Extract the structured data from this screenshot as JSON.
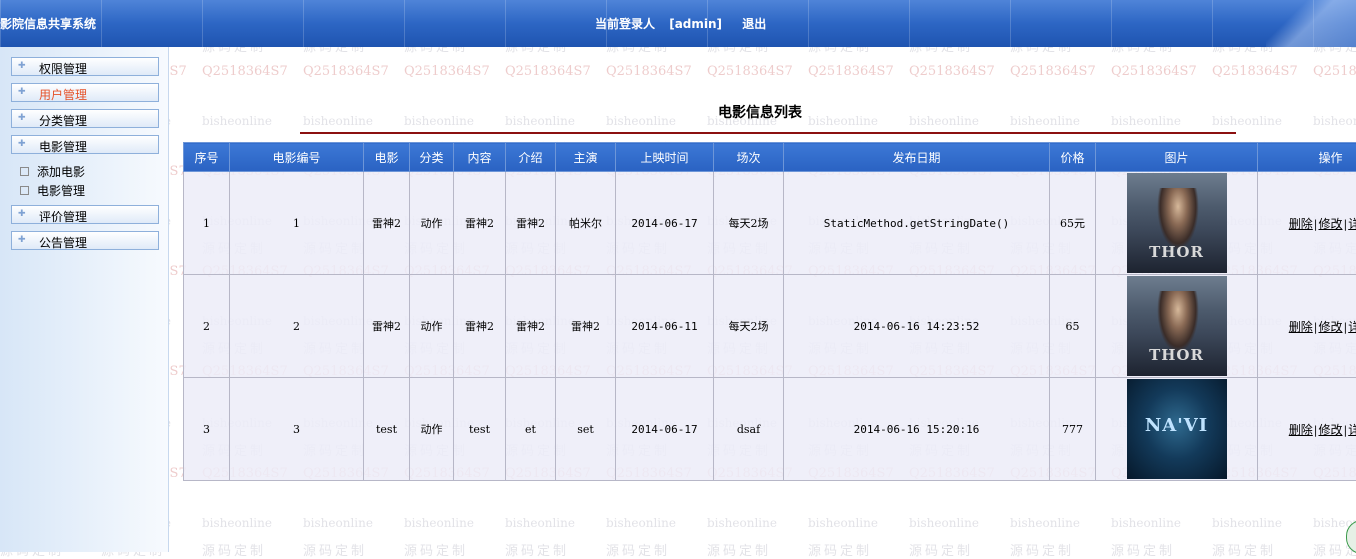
{
  "header": {
    "system_title": "影院信息共享系统",
    "current_user_label": "当前登录人",
    "current_user": "[admin]",
    "logout": "退出"
  },
  "sidebar": {
    "items": [
      {
        "label": "权限管理"
      },
      {
        "label": "用户管理",
        "active": true
      },
      {
        "label": "分类管理"
      },
      {
        "label": "电影管理",
        "expanded": true,
        "children": [
          {
            "label": "添加电影"
          },
          {
            "label": "电影管理"
          }
        ]
      },
      {
        "label": "评价管理"
      },
      {
        "label": "公告管理"
      }
    ]
  },
  "main": {
    "title": "电影信息列表",
    "columns": [
      "序号",
      "电影编号",
      "电影",
      "分类",
      "内容",
      "介绍",
      "主演",
      "上映时间",
      "场次",
      "发布日期",
      "价格",
      "图片",
      "操作"
    ],
    "rows": [
      {
        "index": "1",
        "movie_no": "1",
        "movie": "雷神2",
        "category": "动作",
        "content": "雷神2",
        "intro": "雷神2",
        "actor": "帕米尔",
        "release": "2014-06-17",
        "show": "每天2场",
        "publish": "StaticMethod.getStringDate()",
        "price": "65元",
        "poster": "thor-poster",
        "poster_text": "THOR"
      },
      {
        "index": "2",
        "movie_no": "2",
        "movie": "雷神2",
        "category": "动作",
        "content": "雷神2",
        "intro": "雷神2",
        "actor": "雷神2",
        "release": "2014-06-11",
        "show": "每天2场",
        "publish": "2014-06-16 14:23:52",
        "price": "65",
        "poster": "thor-poster",
        "poster_text": "THOR"
      },
      {
        "index": "3",
        "movie_no": "3",
        "movie": "test",
        "category": "动作",
        "content": "test",
        "intro": "et",
        "actor": "set",
        "release": "2014-06-17",
        "show": "dsaf",
        "publish": "2014-06-16 15:20:16",
        "price": "777",
        "poster": "avatar-poster",
        "poster_text": "NA'VI"
      }
    ],
    "ops": {
      "delete": "删除",
      "edit": "修改",
      "detail": "详细",
      "sep": "|"
    }
  },
  "watermark": {
    "a": "bisheonline",
    "b": "源码定制",
    "c": "Q2518364S7"
  },
  "colors": {
    "header_blue": "#2d66c4",
    "title_line": "#8b1010",
    "active_menu": "#e5522a"
  }
}
